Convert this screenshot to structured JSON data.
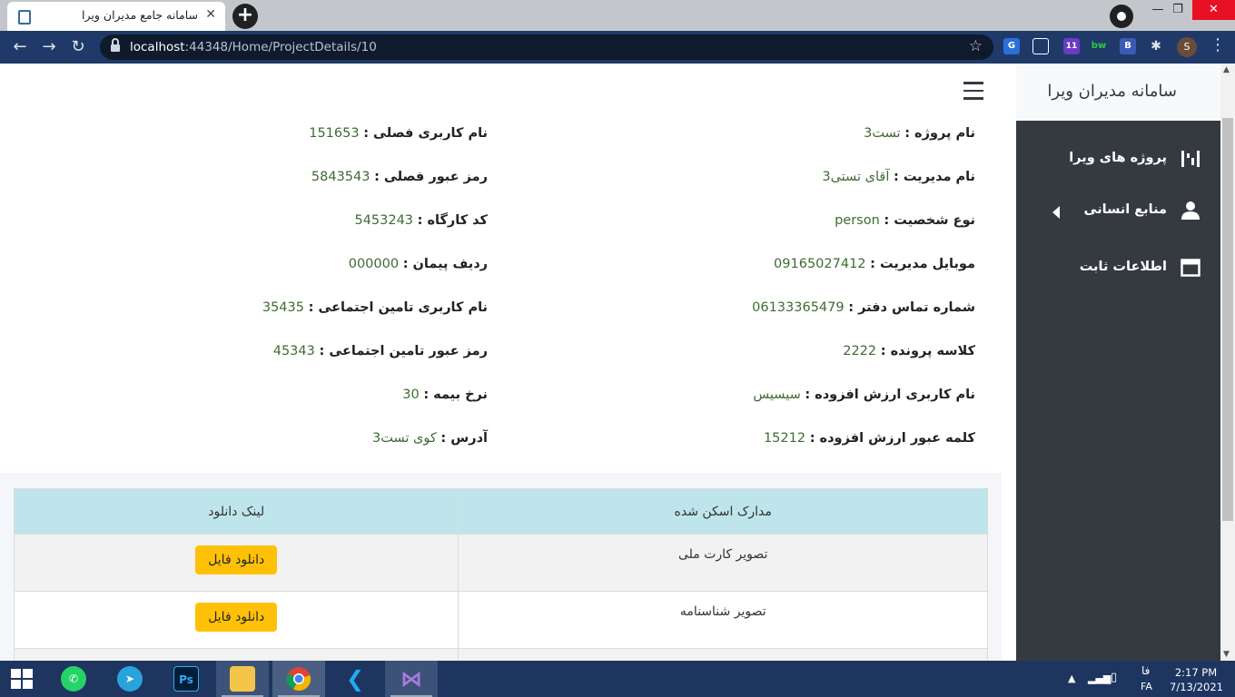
{
  "browser": {
    "tab_title": "سامانه جامع مدیران ویرا",
    "new_tab": "+",
    "url_host": "localhost",
    "url_rest": ":44348/Home/ProjectDetails/10",
    "profile_initial": "S",
    "ext_badge": "11",
    "ext_bw": "bw",
    "ext_b": "B"
  },
  "sidebar": {
    "brand": "سامانه مدیران ویرا",
    "items": [
      {
        "label": "پروژه های ویرا",
        "icon": "project-diagram-icon"
      },
      {
        "label": "منابع انسانی",
        "icon": "user-icon",
        "has_caret": true
      },
      {
        "label": "اطلاعات ثابت",
        "icon": "window-icon"
      }
    ]
  },
  "details": {
    "right": [
      {
        "key": "نام پروژه :",
        "value": "تست3"
      },
      {
        "key": "نام مدیریت :",
        "value": "آقای تستی3"
      },
      {
        "key": "نوع شخصیت :",
        "value": "person"
      },
      {
        "key": "موبایل مدیریت :",
        "value": "09165027412"
      },
      {
        "key": "شماره تماس دفتر :",
        "value": "06133365479"
      },
      {
        "key": "کلاسه پرونده :",
        "value": "2222"
      },
      {
        "key": "نام کاربری ارزش افزوده :",
        "value": "سیسیس"
      },
      {
        "key": "کلمه عبور ارزش افزوده :",
        "value": "15212"
      }
    ],
    "left": [
      {
        "key": "نام کاربری فصلی :",
        "value": "151653"
      },
      {
        "key": "رمز عبور فصلی :",
        "value": "5843543"
      },
      {
        "key": "کد کارگاه :",
        "value": "5453243"
      },
      {
        "key": "ردیف پیمان :",
        "value": "000000"
      },
      {
        "key": "نام کاربری تامین اجتماعی :",
        "value": "35435"
      },
      {
        "key": "رمز عبور تامین اجتماعی :",
        "value": "45343"
      },
      {
        "key": "نرخ بیمه :",
        "value": "30"
      },
      {
        "key": "آدرس :",
        "value": "کوی تست3"
      }
    ]
  },
  "documents": {
    "headers": [
      "مدارک اسکن شده",
      "لینک دانلود"
    ],
    "rows": [
      {
        "name": "تصویر کارت ملی",
        "button": "دانلود فایل"
      },
      {
        "name": "تصویر شناسنامه",
        "button": "دانلود فایل"
      }
    ]
  },
  "taskbar": {
    "lang_fa": "فا",
    "lang_code": "FA",
    "time": "2:17 PM",
    "date": "7/13/2021",
    "ps_label": "Ps"
  },
  "colors": {
    "sidebar_bg": "#343a40",
    "value_green": "#3e6b32",
    "button_yellow": "#ffc107",
    "table_header": "#bee5eb",
    "toolbar": "#1f3a68"
  }
}
